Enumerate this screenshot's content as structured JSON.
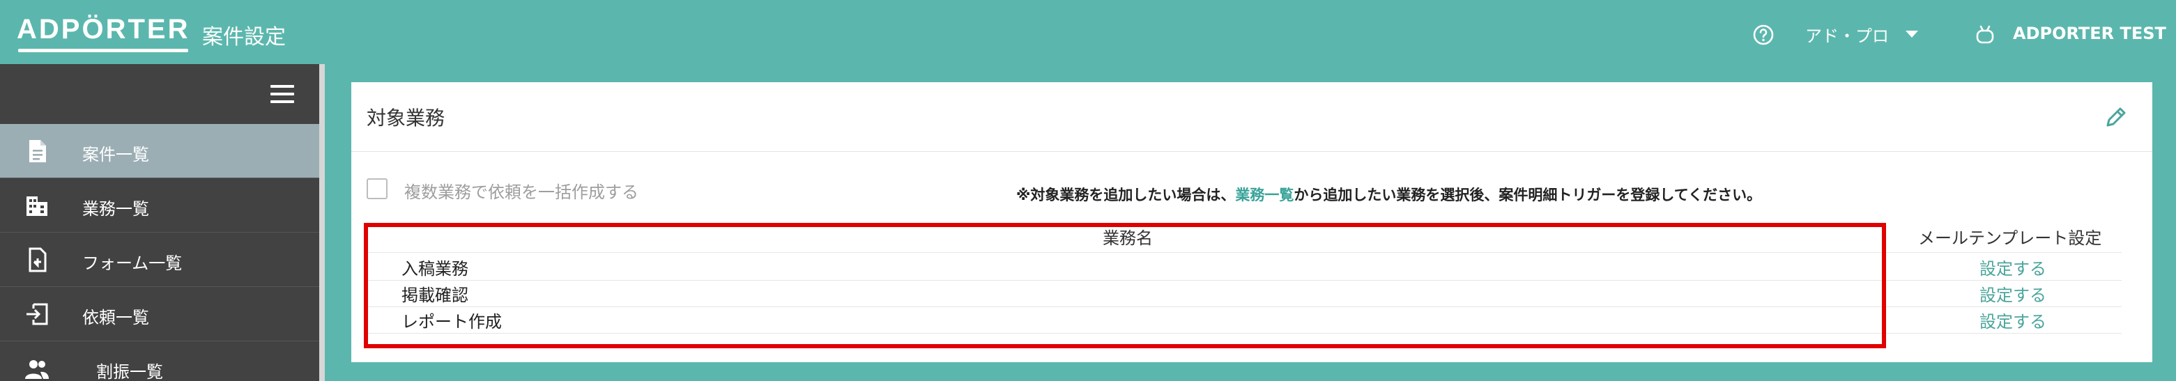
{
  "header": {
    "logo": "ADPÖRTER",
    "title": "案件設定",
    "org": "アド・プロ",
    "user": "ADPORTER TEST"
  },
  "sidebar": {
    "items": [
      {
        "label": "案件一覧",
        "icon": "document-icon",
        "active": true
      },
      {
        "label": "業務一覧",
        "icon": "building-icon",
        "active": false
      },
      {
        "label": "フォーム一覧",
        "icon": "form-icon",
        "active": false
      },
      {
        "label": "依頼一覧",
        "icon": "login-icon",
        "active": false
      },
      {
        "label": "割振一覧",
        "icon": "people-icon",
        "active": false
      }
    ]
  },
  "card": {
    "title": "対象業務",
    "checkbox_label": "複数業務で依頼を一括作成する",
    "notice_prefix": "※対象業務を追加したい場合は、",
    "notice_link": "業務一覧",
    "notice_suffix": "から追加したい業務を選択後、案件明細トリガーを登録してください。"
  },
  "table": {
    "col_task": "業務名",
    "col_template": "メールテンプレート設定",
    "rows": [
      {
        "name": "入稿業務",
        "action": "設定する"
      },
      {
        "name": "掲載確認",
        "action": "設定する"
      },
      {
        "name": "レポート作成",
        "action": "設定する"
      }
    ]
  },
  "colors": {
    "brand": "#5bb7ad",
    "sidebar": "#424242",
    "active_item": "#9baeb4",
    "highlight_border": "#e00000",
    "link": "#4ba59c"
  }
}
